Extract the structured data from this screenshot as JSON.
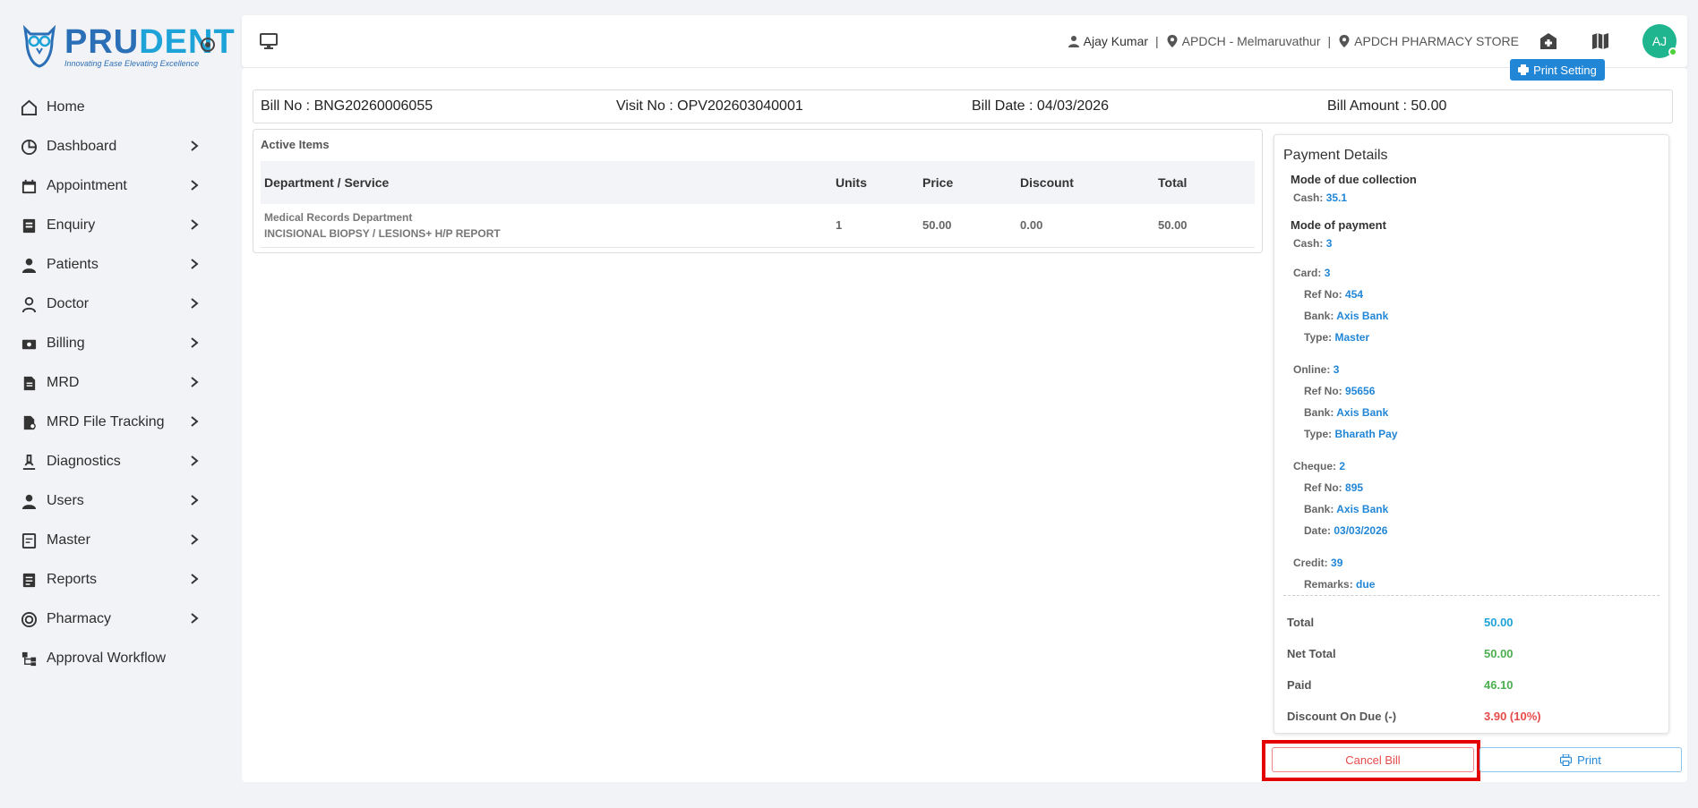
{
  "brand": {
    "name_part1": "PRU",
    "name_part2": "DENT",
    "tagline": "Innovating Ease Elevating Excellence"
  },
  "sidebar": {
    "items": [
      {
        "label": "Home",
        "icon": "home-icon",
        "has_chevron": false
      },
      {
        "label": "Dashboard",
        "icon": "dashboard-icon",
        "has_chevron": true
      },
      {
        "label": "Appointment",
        "icon": "calendar-icon",
        "has_chevron": true
      },
      {
        "label": "Enquiry",
        "icon": "enquiry-icon",
        "has_chevron": true
      },
      {
        "label": "Patients",
        "icon": "person-icon",
        "has_chevron": true
      },
      {
        "label": "Doctor",
        "icon": "doctor-icon",
        "has_chevron": true
      },
      {
        "label": "Billing",
        "icon": "billing-icon",
        "has_chevron": true
      },
      {
        "label": "MRD",
        "icon": "document-icon",
        "has_chevron": true
      },
      {
        "label": "MRD File Tracking",
        "icon": "file-tracking-icon",
        "has_chevron": true
      },
      {
        "label": "Diagnostics",
        "icon": "microscope-icon",
        "has_chevron": true
      },
      {
        "label": "Users",
        "icon": "person-icon",
        "has_chevron": true
      },
      {
        "label": "Master",
        "icon": "master-icon",
        "has_chevron": true
      },
      {
        "label": "Reports",
        "icon": "reports-icon",
        "has_chevron": true
      },
      {
        "label": "Pharmacy",
        "icon": "pharmacy-icon",
        "has_chevron": true
      },
      {
        "label": "Approval Workflow",
        "icon": "workflow-icon",
        "has_chevron": false
      }
    ]
  },
  "topbar": {
    "user_name": "Ajay Kumar",
    "location": "APDCH - Melmaruvathur",
    "store": "APDCH PHARMACY STORE",
    "avatar_initials": "AJ",
    "print_setting_label": "Print Setting"
  },
  "bill": {
    "bill_no": "Bill No : BNG20260006055",
    "visit_no": "Visit No : OPV202603040001",
    "bill_date": "Bill Date : 04/03/2026",
    "bill_amount": "Bill Amount : 50.00"
  },
  "active_items": {
    "title": "Active Items",
    "columns": [
      "Department / Service",
      "Units",
      "Price",
      "Discount",
      "Total"
    ],
    "rows": [
      {
        "department": "Medical Records Department",
        "service": "INCISIONAL BIOPSY / LESIONS+ H/P REPORT",
        "units": "1",
        "price": "50.00",
        "discount": "0.00",
        "total": "50.00"
      }
    ]
  },
  "payment": {
    "title": "Payment Details",
    "due_heading": "Mode of due collection",
    "due_cash_label": "Cash:",
    "due_cash_value": "35.1",
    "mode_heading": "Mode of payment",
    "cash_label": "Cash:",
    "cash_value": "3",
    "card_label": "Card:",
    "card_value": "3",
    "card_ref_label": "Ref No:",
    "card_ref_value": "454",
    "card_bank_label": "Bank:",
    "card_bank_value": "Axis Bank",
    "card_type_label": "Type:",
    "card_type_value": "Master",
    "online_label": "Online:",
    "online_value": "3",
    "online_ref_label": "Ref No:",
    "online_ref_value": "95656",
    "online_bank_label": "Bank:",
    "online_bank_value": "Axis Bank",
    "online_type_label": "Type:",
    "online_type_value": "Bharath Pay",
    "cheque_label": "Cheque:",
    "cheque_value": "2",
    "cheque_ref_label": "Ref No:",
    "cheque_ref_value": "895",
    "cheque_bank_label": "Bank:",
    "cheque_bank_value": "Axis Bank",
    "cheque_date_label": "Date:",
    "cheque_date_value": "03/03/2026",
    "credit_label": "Credit:",
    "credit_value": "39",
    "remarks_label": "Remarks:",
    "remarks_value": "due"
  },
  "summary": {
    "total_label": "Total",
    "total_value": "50.00",
    "net_total_label": "Net Total",
    "net_total_value": "50.00",
    "paid_label": "Paid",
    "paid_value": "46.10",
    "discount_label": "Discount On Due (-)",
    "discount_value": "3.90 (10%)"
  },
  "actions": {
    "cancel_label": "Cancel Bill",
    "print_label": "Print"
  },
  "colors": {
    "accent": "#2186d6",
    "danger": "#e84a4a",
    "success": "#4caf50",
    "highlight": "#e30000"
  }
}
